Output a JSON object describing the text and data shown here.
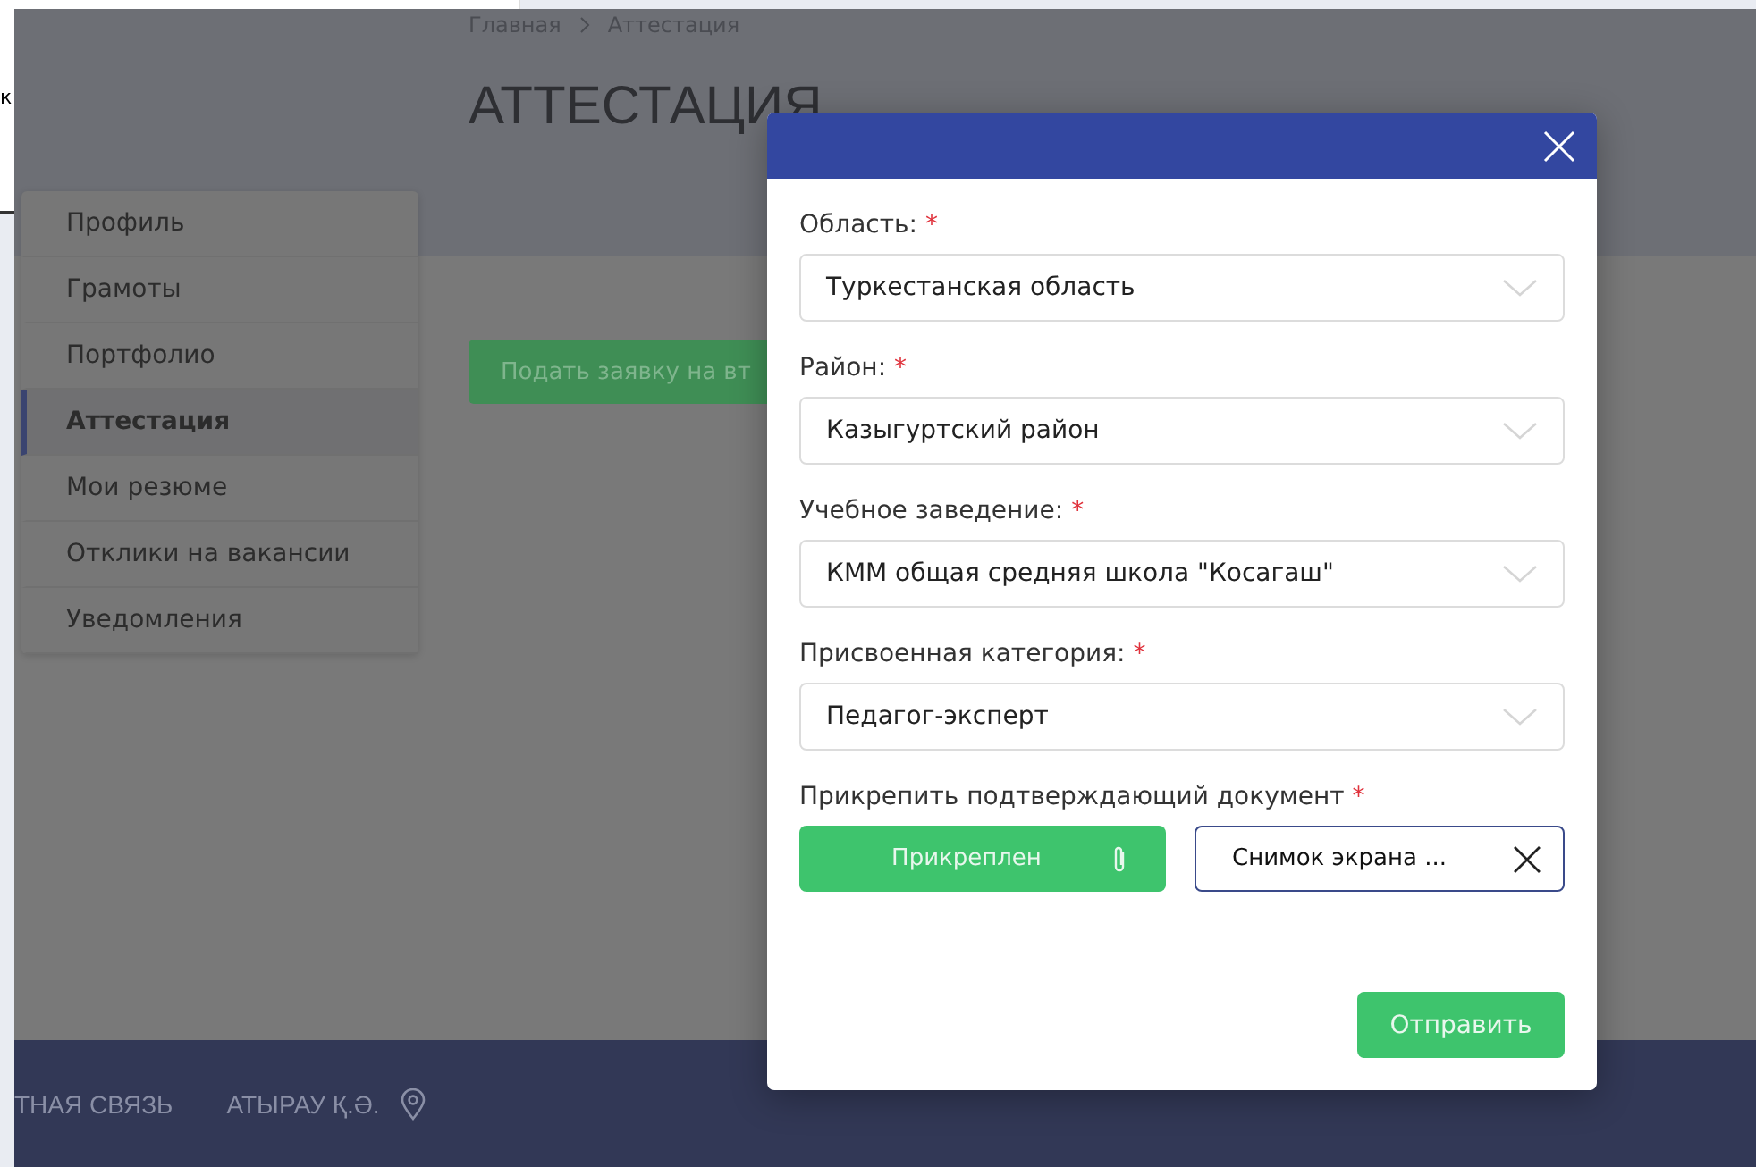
{
  "background_window": {
    "text": "к"
  },
  "breadcrumb": [
    "Главная",
    "Аттестация"
  ],
  "page_title": "АТТЕСТАЦИЯ",
  "sidebar": {
    "items": [
      {
        "label": "Профиль",
        "selected": false
      },
      {
        "label": "Грамоты",
        "selected": false
      },
      {
        "label": "Портфолио",
        "selected": false
      },
      {
        "label": "Аттестация",
        "selected": true
      },
      {
        "label": "Мои резюме",
        "selected": false
      },
      {
        "label": "Отклики на вакансии",
        "selected": false
      },
      {
        "label": "Уведомления",
        "selected": false
      }
    ]
  },
  "apply_button": "Подать заявку на вт",
  "footer": {
    "links": [
      "ТНАЯ СВЯЗЬ",
      "АТЫРАУ Қ.Ә."
    ]
  },
  "modal": {
    "fields": [
      {
        "label": "Область:",
        "required_mark": "*",
        "value": "Туркестанская область"
      },
      {
        "label": "Район:",
        "required_mark": "*",
        "value": "Казыгуртский район"
      },
      {
        "label": "Учебное заведение:",
        "required_mark": "*",
        "value": "КММ общая средняя школа \"Косагаш\""
      },
      {
        "label": "Присвоенная категория:",
        "required_mark": "*",
        "value": "Педагог-эксперт"
      }
    ],
    "attachment": {
      "label": "Прикрепить подтверждающий документ",
      "required_mark": "*",
      "button": "Прикреплен",
      "file_name": "Снимок экрана ..."
    },
    "submit": "Отправить"
  }
}
